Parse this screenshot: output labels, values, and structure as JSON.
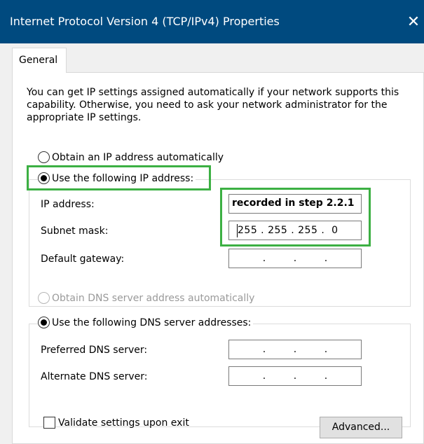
{
  "window": {
    "title": "Internet Protocol Version 4 (TCP/IPv4) Properties",
    "close_glyph": "✕"
  },
  "tabs": [
    {
      "label": "General",
      "selected": true
    }
  ],
  "description": "You can get IP settings assigned automatically if your network supports this capability. Otherwise, you need to ask your network administrator for the appropriate IP settings.",
  "ip": {
    "auto_label": "Obtain an IP address automatically",
    "manual_label": "Use the following IP address:",
    "selected": "manual",
    "fields": {
      "ip_address": {
        "label": "IP address:",
        "value": "recorded in step 2.2.1"
      },
      "subnet_mask": {
        "label": "Subnet mask:",
        "value": "255 . 255 . 255 .  0"
      },
      "default_gateway": {
        "label": "Default gateway:",
        "value": ""
      }
    }
  },
  "dns": {
    "auto_label": "Obtain DNS server address automatically",
    "manual_label": "Use the following DNS server addresses:",
    "selected": "manual",
    "auto_disabled": true,
    "fields": {
      "preferred": {
        "label": "Preferred DNS server:",
        "value": ""
      },
      "alternate": {
        "label": "Alternate DNS server:",
        "value": ""
      }
    }
  },
  "validate_label": "Validate settings upon exit",
  "validate_checked": false,
  "advanced_label": "Advanced...",
  "colors": {
    "titlebar": "#004a7f",
    "highlight": "#3cb043",
    "dialog_bg": "#f0f0f0"
  }
}
